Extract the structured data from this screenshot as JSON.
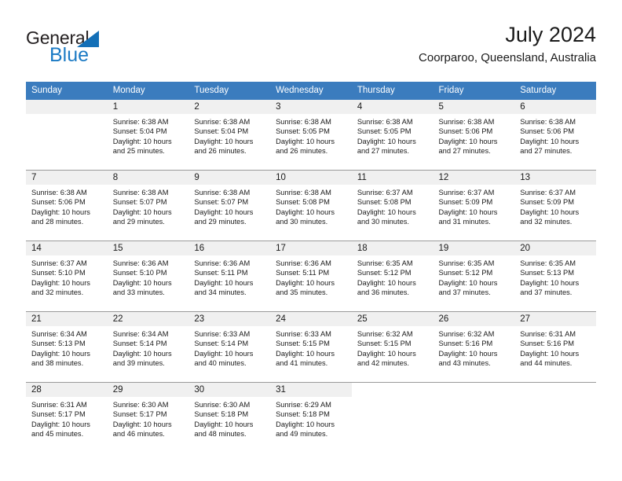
{
  "logo": {
    "word_one": "General",
    "word_two": "Blue",
    "triangle_color": "#136fb7",
    "blue_color": "#1b7ac4"
  },
  "header": {
    "title": "July 2024",
    "subtitle": "Coorparoo, Queensland, Australia"
  },
  "theme": {
    "header_blue": "#3b7cbe",
    "date_band_gray": "#f0f0f0",
    "grid_line": "#9a9a9a"
  },
  "calendar": {
    "weekday_headers": [
      "Sunday",
      "Monday",
      "Tuesday",
      "Wednesday",
      "Thursday",
      "Friday",
      "Saturday"
    ],
    "weeks": [
      [
        {
          "day": "",
          "lines": []
        },
        {
          "day": "1",
          "lines": [
            "Sunrise: 6:38 AM",
            "Sunset: 5:04 PM",
            "Daylight: 10 hours",
            "and 25 minutes."
          ]
        },
        {
          "day": "2",
          "lines": [
            "Sunrise: 6:38 AM",
            "Sunset: 5:04 PM",
            "Daylight: 10 hours",
            "and 26 minutes."
          ]
        },
        {
          "day": "3",
          "lines": [
            "Sunrise: 6:38 AM",
            "Sunset: 5:05 PM",
            "Daylight: 10 hours",
            "and 26 minutes."
          ]
        },
        {
          "day": "4",
          "lines": [
            "Sunrise: 6:38 AM",
            "Sunset: 5:05 PM",
            "Daylight: 10 hours",
            "and 27 minutes."
          ]
        },
        {
          "day": "5",
          "lines": [
            "Sunrise: 6:38 AM",
            "Sunset: 5:06 PM",
            "Daylight: 10 hours",
            "and 27 minutes."
          ]
        },
        {
          "day": "6",
          "lines": [
            "Sunrise: 6:38 AM",
            "Sunset: 5:06 PM",
            "Daylight: 10 hours",
            "and 27 minutes."
          ]
        }
      ],
      [
        {
          "day": "7",
          "lines": [
            "Sunrise: 6:38 AM",
            "Sunset: 5:06 PM",
            "Daylight: 10 hours",
            "and 28 minutes."
          ]
        },
        {
          "day": "8",
          "lines": [
            "Sunrise: 6:38 AM",
            "Sunset: 5:07 PM",
            "Daylight: 10 hours",
            "and 29 minutes."
          ]
        },
        {
          "day": "9",
          "lines": [
            "Sunrise: 6:38 AM",
            "Sunset: 5:07 PM",
            "Daylight: 10 hours",
            "and 29 minutes."
          ]
        },
        {
          "day": "10",
          "lines": [
            "Sunrise: 6:38 AM",
            "Sunset: 5:08 PM",
            "Daylight: 10 hours",
            "and 30 minutes."
          ]
        },
        {
          "day": "11",
          "lines": [
            "Sunrise: 6:37 AM",
            "Sunset: 5:08 PM",
            "Daylight: 10 hours",
            "and 30 minutes."
          ]
        },
        {
          "day": "12",
          "lines": [
            "Sunrise: 6:37 AM",
            "Sunset: 5:09 PM",
            "Daylight: 10 hours",
            "and 31 minutes."
          ]
        },
        {
          "day": "13",
          "lines": [
            "Sunrise: 6:37 AM",
            "Sunset: 5:09 PM",
            "Daylight: 10 hours",
            "and 32 minutes."
          ]
        }
      ],
      [
        {
          "day": "14",
          "lines": [
            "Sunrise: 6:37 AM",
            "Sunset: 5:10 PM",
            "Daylight: 10 hours",
            "and 32 minutes."
          ]
        },
        {
          "day": "15",
          "lines": [
            "Sunrise: 6:36 AM",
            "Sunset: 5:10 PM",
            "Daylight: 10 hours",
            "and 33 minutes."
          ]
        },
        {
          "day": "16",
          "lines": [
            "Sunrise: 6:36 AM",
            "Sunset: 5:11 PM",
            "Daylight: 10 hours",
            "and 34 minutes."
          ]
        },
        {
          "day": "17",
          "lines": [
            "Sunrise: 6:36 AM",
            "Sunset: 5:11 PM",
            "Daylight: 10 hours",
            "and 35 minutes."
          ]
        },
        {
          "day": "18",
          "lines": [
            "Sunrise: 6:35 AM",
            "Sunset: 5:12 PM",
            "Daylight: 10 hours",
            "and 36 minutes."
          ]
        },
        {
          "day": "19",
          "lines": [
            "Sunrise: 6:35 AM",
            "Sunset: 5:12 PM",
            "Daylight: 10 hours",
            "and 37 minutes."
          ]
        },
        {
          "day": "20",
          "lines": [
            "Sunrise: 6:35 AM",
            "Sunset: 5:13 PM",
            "Daylight: 10 hours",
            "and 37 minutes."
          ]
        }
      ],
      [
        {
          "day": "21",
          "lines": [
            "Sunrise: 6:34 AM",
            "Sunset: 5:13 PM",
            "Daylight: 10 hours",
            "and 38 minutes."
          ]
        },
        {
          "day": "22",
          "lines": [
            "Sunrise: 6:34 AM",
            "Sunset: 5:14 PM",
            "Daylight: 10 hours",
            "and 39 minutes."
          ]
        },
        {
          "day": "23",
          "lines": [
            "Sunrise: 6:33 AM",
            "Sunset: 5:14 PM",
            "Daylight: 10 hours",
            "and 40 minutes."
          ]
        },
        {
          "day": "24",
          "lines": [
            "Sunrise: 6:33 AM",
            "Sunset: 5:15 PM",
            "Daylight: 10 hours",
            "and 41 minutes."
          ]
        },
        {
          "day": "25",
          "lines": [
            "Sunrise: 6:32 AM",
            "Sunset: 5:15 PM",
            "Daylight: 10 hours",
            "and 42 minutes."
          ]
        },
        {
          "day": "26",
          "lines": [
            "Sunrise: 6:32 AM",
            "Sunset: 5:16 PM",
            "Daylight: 10 hours",
            "and 43 minutes."
          ]
        },
        {
          "day": "27",
          "lines": [
            "Sunrise: 6:31 AM",
            "Sunset: 5:16 PM",
            "Daylight: 10 hours",
            "and 44 minutes."
          ]
        }
      ],
      [
        {
          "day": "28",
          "lines": [
            "Sunrise: 6:31 AM",
            "Sunset: 5:17 PM",
            "Daylight: 10 hours",
            "and 45 minutes."
          ]
        },
        {
          "day": "29",
          "lines": [
            "Sunrise: 6:30 AM",
            "Sunset: 5:17 PM",
            "Daylight: 10 hours",
            "and 46 minutes."
          ]
        },
        {
          "day": "30",
          "lines": [
            "Sunrise: 6:30 AM",
            "Sunset: 5:18 PM",
            "Daylight: 10 hours",
            "and 48 minutes."
          ]
        },
        {
          "day": "31",
          "lines": [
            "Sunrise: 6:29 AM",
            "Sunset: 5:18 PM",
            "Daylight: 10 hours",
            "and 49 minutes."
          ]
        },
        {
          "day": "",
          "lines": []
        },
        {
          "day": "",
          "lines": []
        },
        {
          "day": "",
          "lines": []
        }
      ]
    ]
  }
}
